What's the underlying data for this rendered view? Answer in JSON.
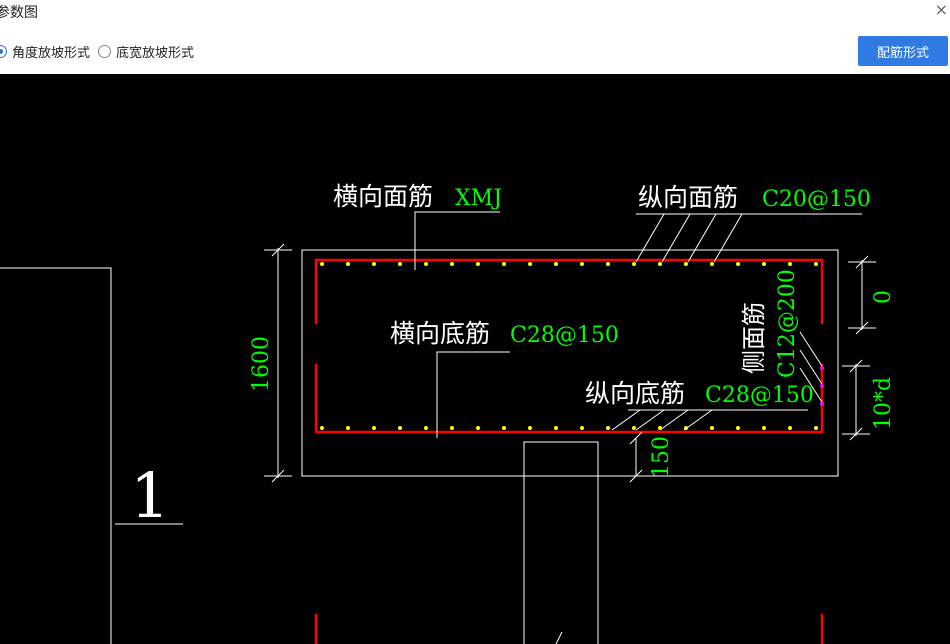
{
  "window": {
    "title": "参数图",
    "close_glyph": "×"
  },
  "options": {
    "radio1_label": "角度放坡形式",
    "radio2_label": "底宽放坡形式",
    "selected": "radio1"
  },
  "toolbar": {
    "rebar_button_label": "配筋形式"
  },
  "drawing": {
    "label_top_transverse": "横向面筋",
    "value_top_transverse": "XMJ",
    "label_top_longitudinal": "纵向面筋",
    "value_top_longitudinal": "C20@150",
    "label_bottom_transverse": "横向底筋",
    "value_bottom_transverse": "C28@150",
    "label_bottom_longitudinal": "纵向底筋",
    "value_bottom_longitudinal": "C28@150",
    "label_side": "侧面筋",
    "value_side": "C12@200",
    "dim_height": "1600",
    "dim_top": "0",
    "dim_side": "10*d",
    "dim_bottom": "150",
    "section_mark": "1"
  },
  "colors": {
    "rebar": "#ff0000",
    "rebar_points": "#ffff00",
    "side_points": "#ff00ff",
    "value_text": "#00ff00",
    "label_text": "#ffffff"
  }
}
